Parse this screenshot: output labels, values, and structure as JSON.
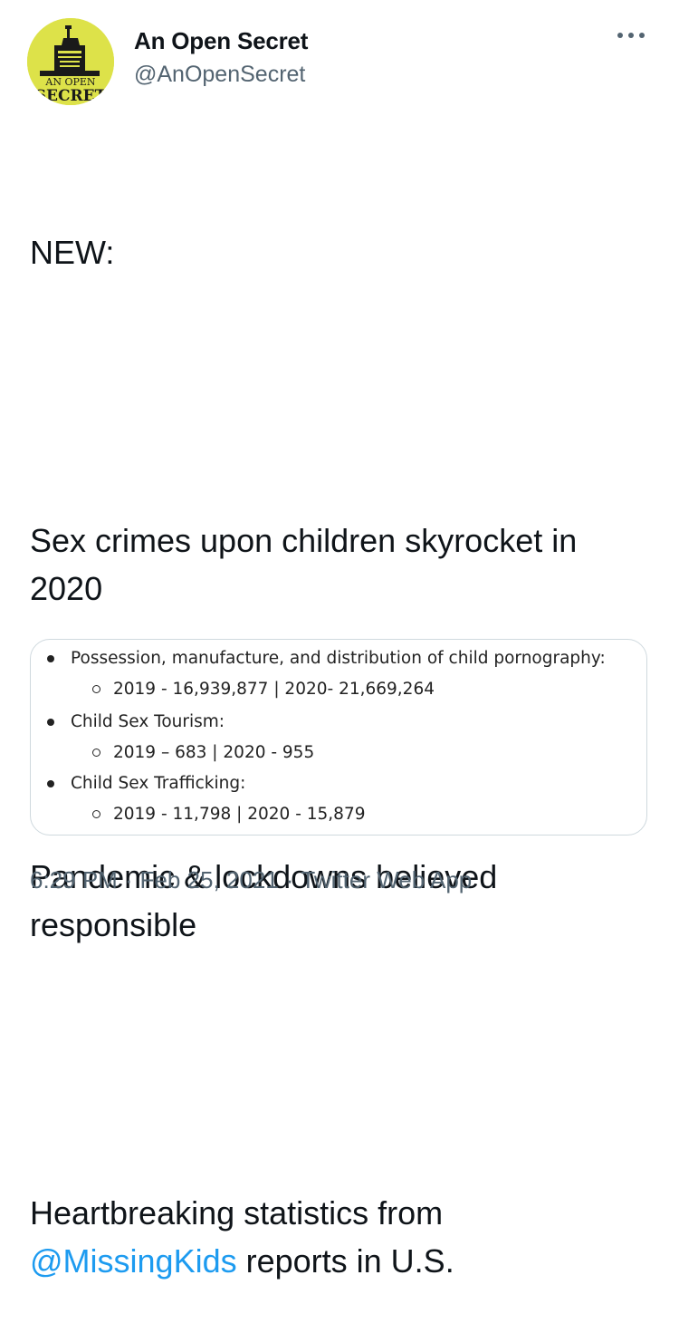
{
  "author": {
    "display_name": "An Open Secret",
    "handle": "@AnOpenSecret",
    "avatar_text_top": "AN OPEN",
    "avatar_text_bottom": "SECRET",
    "avatar_icon": "statue-of-liberty-logo",
    "avatar_color": "#dde249"
  },
  "more_icon": "ellipsis-icon",
  "tweet": {
    "line1": "NEW:",
    "line2": "Sex crimes upon children skyrocket in 2020",
    "line3": "Pandemic & lockdowns believed responsible",
    "line4_prefix": "Heartbreaking statistics from ",
    "line4_mention": "@MissingKids",
    "line4_suffix": " reports in U.S."
  },
  "image_card": {
    "items": [
      {
        "label": "Possession, manufacture, and distribution of child pornography:",
        "detail": "2019 - 16,939,877 | 2020- 21,669,264"
      },
      {
        "label": "Child Sex Tourism:",
        "detail": "2019 – 683 | 2020 - 955"
      },
      {
        "label": "Child Sex Trafficking:",
        "detail": "2019 - 11,798 | 2020 - 15,879"
      }
    ]
  },
  "meta": {
    "time": "6:29 PM",
    "date": "Feb 25, 2021",
    "separator": "·",
    "source": "Twitter Web App"
  },
  "colors": {
    "link": "#1d9bf0",
    "secondary_text": "#536471",
    "border": "#cfd9de"
  }
}
